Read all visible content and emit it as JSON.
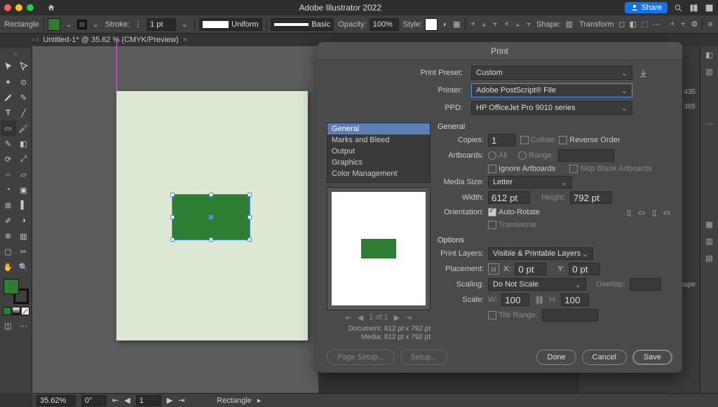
{
  "titlebar": {
    "app_title": "Adobe Illustrator 2022",
    "share_label": "Share"
  },
  "optbar": {
    "shape_label": "Rectangle",
    "stroke_label": "Stroke:",
    "stroke_value": "1 pt",
    "uniform_label": "Uniform",
    "basic_label": "Basic",
    "opacity_label": "Opacity:",
    "opacity_value": "100%",
    "style_label": "Style:",
    "shape_text": "Shape:",
    "transform_text": "Transform"
  },
  "doc_tab": "Untitled-1* @ 35.62 % (CMYK/Preview)",
  "rightpanels": {
    "val1": "435",
    "val2": "365",
    "dshape": "d Shape"
  },
  "status": {
    "zoom": "35.62%",
    "rotate": "0°",
    "artboard": "1",
    "sel": "Rectangle"
  },
  "canvas": {
    "artboard_bg": "#dce8d4",
    "rect_fill": "#2e7d32"
  },
  "print": {
    "title": "Print",
    "preset_label": "Print Preset:",
    "preset_value": "Custom",
    "printer_label": "Printer:",
    "printer_value": "Adobe PostScript® File",
    "ppd_label": "PPD:",
    "ppd_value": "HP OfficeJet Pro 9010 series",
    "categories": [
      "General",
      "Marks and Bleed",
      "Output",
      "Graphics",
      "Color Management"
    ],
    "selected_category": 0,
    "general_head": "General",
    "copies_label": "Copies:",
    "copies_value": "1",
    "collate_label": "Collate",
    "reverse_label": "Reverse Order",
    "artboards_label": "Artboards:",
    "all_label": "All",
    "range_label": "Range:",
    "ignore_artboards_label": "Ignore Artboards",
    "skip_blank_label": "Skip Blank Artboards",
    "media_size_label": "Media Size:",
    "media_size_value": "Letter",
    "width_label": "Width:",
    "width_value": "612 pt",
    "height_label": "Height:",
    "height_value": "792 pt",
    "orientation_label": "Orientation:",
    "auto_rotate_label": "Auto-Rotate",
    "transverse_label": "Transverse",
    "options_head": "Options",
    "print_layers_label": "Print Layers:",
    "print_layers_value": "Visible & Printable Layers",
    "placement_label": "Placement:",
    "x_label": "X:",
    "x_value": "0 pt",
    "y_label": "Y:",
    "y_value": "0 pt",
    "scaling_label": "Scaling:",
    "scaling_value": "Do Not Scale",
    "overlap_label": "Overlap:",
    "scale_label": "Scale:",
    "scale_w_label": "W:",
    "scale_w_value": "100",
    "scale_h_label": "H:",
    "scale_h_value": "100",
    "tile_range_label": "Tile Range:",
    "page_nav": "1 of 1",
    "doc_size": "Document: 612 pt x 792 pt",
    "media_size_info": "Media: 612 pt x 792 pt",
    "buttons": {
      "page_setup": "Page Setup...",
      "setup": "Setup...",
      "done": "Done",
      "cancel": "Cancel",
      "save": "Save"
    }
  }
}
